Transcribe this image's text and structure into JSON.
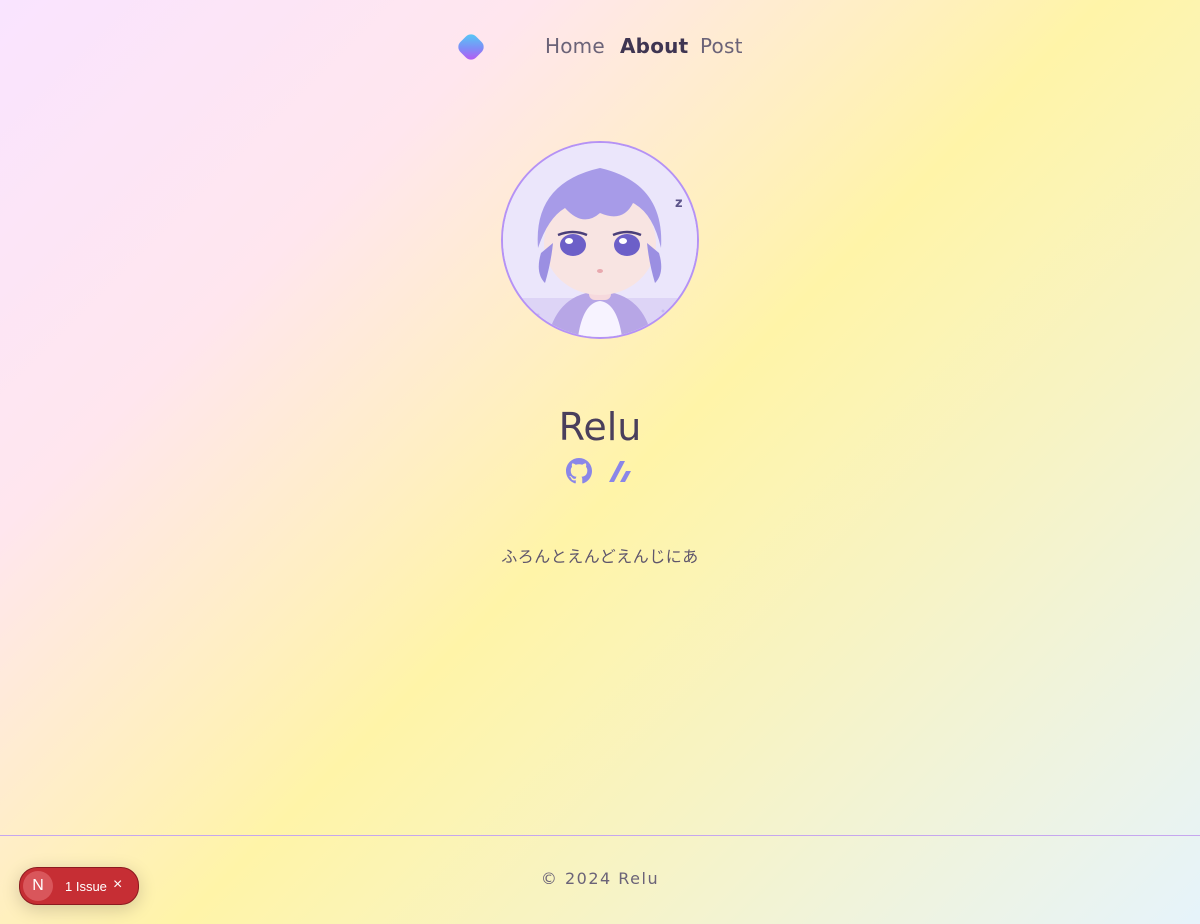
{
  "nav": {
    "logo": "gradient-diamond-logo",
    "links": [
      {
        "label": "Home"
      },
      {
        "label": "About",
        "active": true
      },
      {
        "label": "Post"
      }
    ]
  },
  "profile": {
    "avatar": "anime-avatar-image",
    "name": "Relu",
    "socials": [
      "github-icon",
      "zenn-icon"
    ],
    "tagline": "ふろんとえんどえんじにあ"
  },
  "footer": {
    "copyright": "© 2024 Relu"
  },
  "dev_indicator": {
    "badge": "N",
    "label": "1 Issue",
    "close": "×"
  },
  "colors": {
    "accent": "#b592f5",
    "icon": "#8a86e8",
    "issue_red": "#c62e34"
  }
}
